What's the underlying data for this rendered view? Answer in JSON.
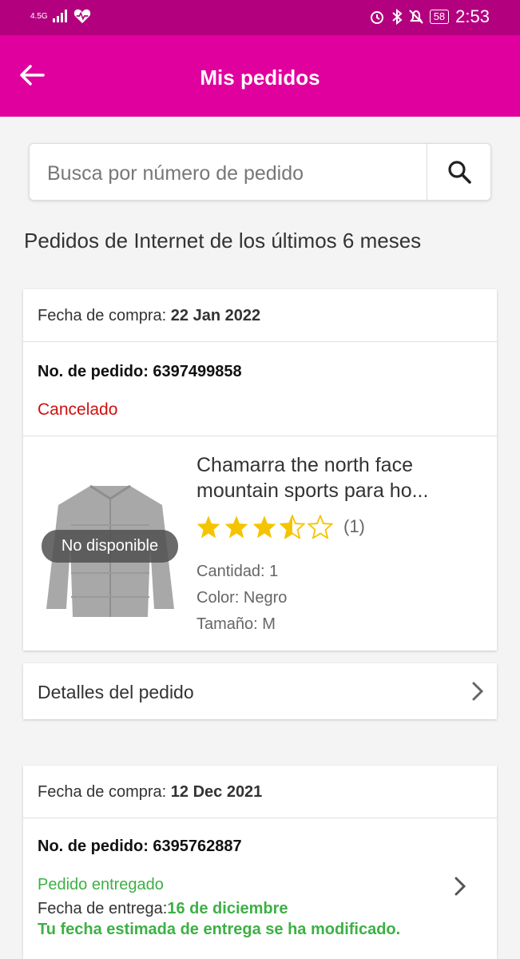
{
  "status_bar": {
    "network": "4.5G",
    "time": "2:53",
    "battery": "58"
  },
  "header": {
    "title": "Mis pedidos"
  },
  "search": {
    "placeholder": "Busca por número de pedido"
  },
  "section_title": "Pedidos de Internet de los últimos 6 meses",
  "orders": [
    {
      "date_label": "Fecha de compra:",
      "date_value": "22  Jan 2022",
      "order_label": "No. de pedido: 6397499858",
      "status": "Cancelado",
      "status_color": "#d01010",
      "product": {
        "name": "Chamarra the north face mountain sports para ho...",
        "badge": "No disponible",
        "rating": 3.5,
        "reviews": "(1)",
        "quantity": "Cantidad: 1",
        "color": "Color: Negro",
        "size": "Tamaño: M"
      },
      "details_label": "Detalles del pedido"
    },
    {
      "date_label": "Fecha de compra:",
      "date_value": "12  Dec 2021",
      "order_label": "No. de pedido: 6395762887",
      "status": "Pedido entregado",
      "status_color": "#3db045",
      "delivery_label": "Fecha de entrega:",
      "delivery_value": "16 de diciembre",
      "delivery_note": "Tu fecha estimada de entrega se ha modificado."
    }
  ],
  "colors": {
    "status_bar": "#b3007f",
    "app_bar": "#e0009e",
    "star": "#f5c400",
    "green": "#3db045",
    "red": "#d01010"
  }
}
